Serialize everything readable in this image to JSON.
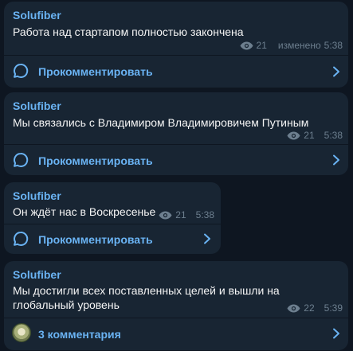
{
  "messages": [
    {
      "author": "Solufiber",
      "text": "Работа над стартапом полностью закончена",
      "views": "21",
      "edited": "изменено",
      "time": "5:38",
      "comment_label": "Прокомментировать"
    },
    {
      "author": "Solufiber",
      "text": "Мы связались с Владимиром Владимировичем Путиным",
      "views": "21",
      "time": "5:38",
      "comment_label": "Прокомментировать"
    },
    {
      "author": "Solufiber",
      "text": "Он ждёт нас в Воскресенье",
      "views": "21",
      "time": "5:38",
      "comment_label": "Прокомментировать"
    },
    {
      "author": "Solufiber",
      "text": "Мы достигли всех поставленных целей и вышли на глобальный уровень",
      "views": "22",
      "time": "5:39",
      "comment_label": "3 комментария"
    }
  ],
  "icons": {
    "views": "eye-icon",
    "comment": "comment-bubble-icon",
    "chevron": "chevron-right-icon",
    "commenter": "commenter-avatar"
  },
  "colors": {
    "background": "#0e1621",
    "bubble": "#182533",
    "accent": "#6ab3f3",
    "meta": "#6d7f8f"
  }
}
